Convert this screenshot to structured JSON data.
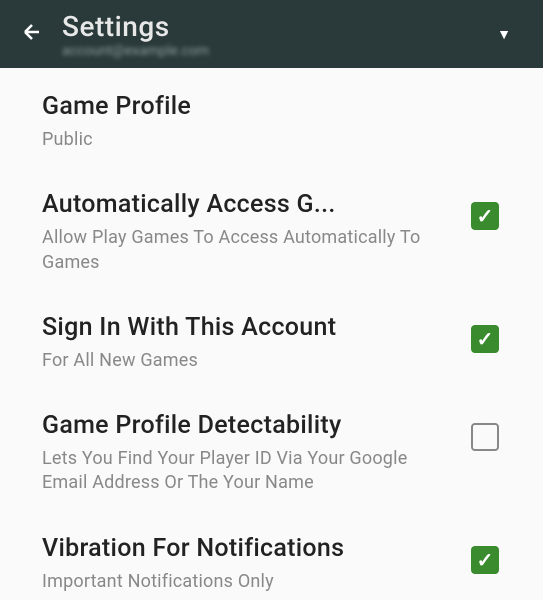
{
  "header": {
    "title": "Settings",
    "subtitle": "account@example.com"
  },
  "items": [
    {
      "title": "Game Profile",
      "subtitle": "Public",
      "hasCheckbox": false
    },
    {
      "title": "Automatically Access G...",
      "subtitle": "Allow Play Games To Access Automatically To Games",
      "hasCheckbox": true,
      "checked": true
    },
    {
      "title": "Sign In With This Account",
      "subtitle": "For All New Games",
      "hasCheckbox": true,
      "checked": true
    },
    {
      "title": "Game Profile Detectability",
      "subtitle": "Lets You Find Your Player ID Via Your Google Email Address Or The Your Name",
      "hasCheckbox": true,
      "checked": false
    },
    {
      "title": "Vibration For Notifications",
      "subtitle": "Important Notifications Only",
      "hasCheckbox": true,
      "checked": true
    }
  ]
}
